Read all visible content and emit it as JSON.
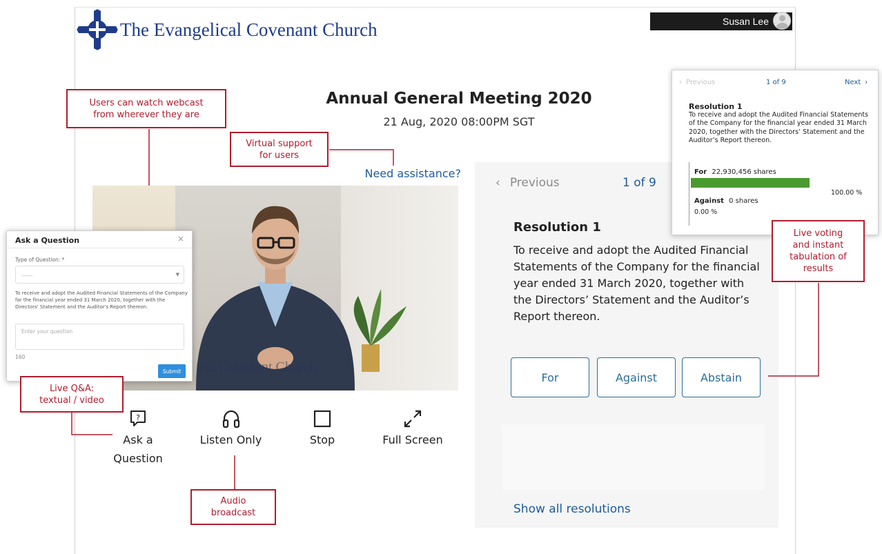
{
  "header": {
    "org_name": "The Evangelical Covenant Church",
    "user_name": "Susan Lee"
  },
  "meeting": {
    "title": "Annual General Meeting 2020",
    "datetime": "21 Aug, 2020 08:00PM SGT",
    "assistance_link": "Need assistance?"
  },
  "video": {
    "watermark": "ical Covenant Church"
  },
  "controls": [
    {
      "label": "Ask a Question",
      "icon": "chat-question-icon"
    },
    {
      "label": "Listen Only",
      "icon": "headphones-icon"
    },
    {
      "label": "Stop",
      "icon": "stop-square-icon"
    },
    {
      "label": "Full Screen",
      "icon": "expand-arrows-icon"
    }
  ],
  "voting": {
    "previous": "Previous",
    "counter": "1 of 9",
    "resolution_title": "Resolution 1",
    "resolution_text": "To receive and adopt the Audited Financial Statements of the Company for the financial year ended 31 March 2020, together with the Directors’ Statement and the Auditor’s Report thereon.",
    "buttons": {
      "for": "For",
      "against": "Against",
      "abstain": "Abstain"
    },
    "show_all": "Show all resolutions"
  },
  "results_card": {
    "previous": "Previous",
    "counter": "1 of 9",
    "next": "Next",
    "resolution_title": "Resolution 1",
    "resolution_text": "To receive and adopt the Audited Financial Statements of the Company for the financial year ended 31 March 2020, together with the Directors’ Statement and the Auditor’s Report thereon.",
    "for_label": "For",
    "for_shares": "22,930,456 shares",
    "for_percent": "100.00 %",
    "for_fraction": 1.0,
    "against_label": "Against",
    "against_shares": "0 shares",
    "against_percent": "0.00 %",
    "bar_color": "#4a9b2f"
  },
  "question_dialog": {
    "title": "Ask a Question",
    "close": "×",
    "type_label": "Type of Question: *",
    "type_value": "------",
    "description": "To receive and adopt the Audited Financial Statements of the Company for the financial year ended 31 March 2020, together with the Directors' Statement and the Auditor's Report thereon.",
    "question_placeholder": "Enter your question",
    "char_count": "160",
    "submit": "Submit"
  },
  "annotations": {
    "webcast": "Users can watch webcast\nfrom wherever they are",
    "support": "Virtual support\nfor users",
    "voting": "Live voting\nand instant\ntabulation of\nresults",
    "qa": "Live Q&A:\ntextual / video",
    "audio": "Audio\nbroadcast"
  },
  "colors": {
    "annotation": "#b01c2e",
    "accent": "#1e5a9c",
    "button_border": "#2a6f97",
    "brand": "#1f3c8c"
  }
}
